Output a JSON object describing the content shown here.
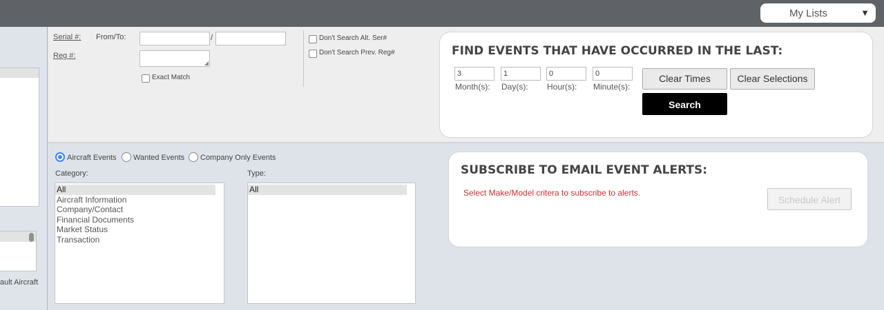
{
  "header": {
    "my_lists_label": "My Lists",
    "dropdown_arrow": "▼"
  },
  "left_panel": {
    "bottom_text": "ault Aircraft"
  },
  "search_form": {
    "serial_label": "Serial #:",
    "from_to_label": "From/To:",
    "separator": "/",
    "reg_label": "Reg #:",
    "exact_match_label": "Exact Match",
    "dont_search_alt_label": "Don't Search Alt. Ser#",
    "dont_search_prev_label": "Don't Search Prev. Reg#"
  },
  "events_card": {
    "title": "FIND EVENTS THAT HAVE OCCURRED IN THE LAST:",
    "fields": [
      {
        "value": "3",
        "label": "Month(s):"
      },
      {
        "value": "1",
        "label": "Day(s):"
      },
      {
        "value": "0",
        "label": "Hour(s):"
      },
      {
        "value": "0",
        "label": "Minute(s):"
      }
    ],
    "clear_times_label": "Clear Times",
    "clear_selections_label": "Clear Selections",
    "search_label": "Search"
  },
  "event_filters": {
    "radios": [
      {
        "label": "Aircraft Events",
        "selected": true
      },
      {
        "label": "Wanted Events",
        "selected": false
      },
      {
        "label": "Company Only Events",
        "selected": false
      }
    ],
    "category_label": "Category:",
    "type_label": "Type:",
    "categories": [
      "All",
      "Aircraft Information",
      "Company/Contact",
      "Financial Documents",
      "Market Status",
      "Transaction"
    ],
    "types": [
      "All"
    ]
  },
  "subscribe_card": {
    "title": "SUBSCRIBE TO EMAIL EVENT ALERTS:",
    "message": "Select Make/Model critera to subscribe to alerts.",
    "message_color": "#d32f2f",
    "schedule_alert_label": "Schedule Alert"
  }
}
